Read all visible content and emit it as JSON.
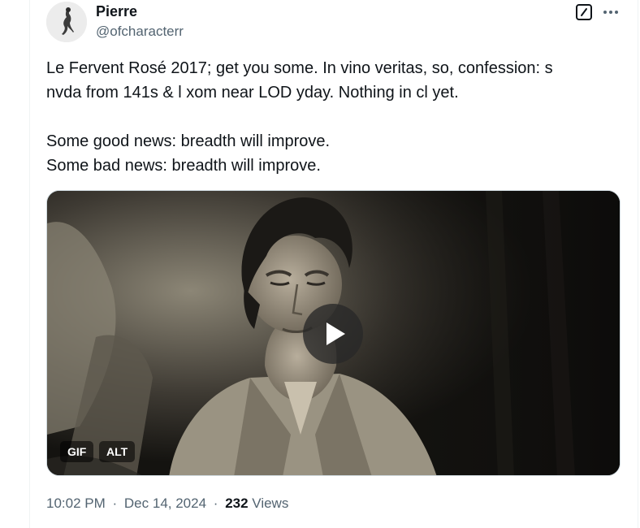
{
  "author": {
    "display_name": "Pierre",
    "handle": "@ofcharacterr"
  },
  "tweet": {
    "lines": [
      "Le Fervent Rosé 2017; get you some. In vino veritas, so, confession: s",
      "nvda from 141s & l xom near LOD yday. Nothing in cl yet.",
      "Some good news: breadth will improve.",
      "Some bad news: breadth will improve."
    ]
  },
  "media": {
    "badge_gif": "GIF",
    "badge_alt": "ALT",
    "play_icon": "play-icon"
  },
  "meta": {
    "time": "10:02 PM",
    "separator": "·",
    "date": "Dec 14, 2024",
    "views_count": "232",
    "views_label": "Views"
  },
  "icons": {
    "grok": "grok-icon",
    "more": "more-icon"
  },
  "colors": {
    "text_primary": "#0f1419",
    "text_secondary": "#536471"
  }
}
